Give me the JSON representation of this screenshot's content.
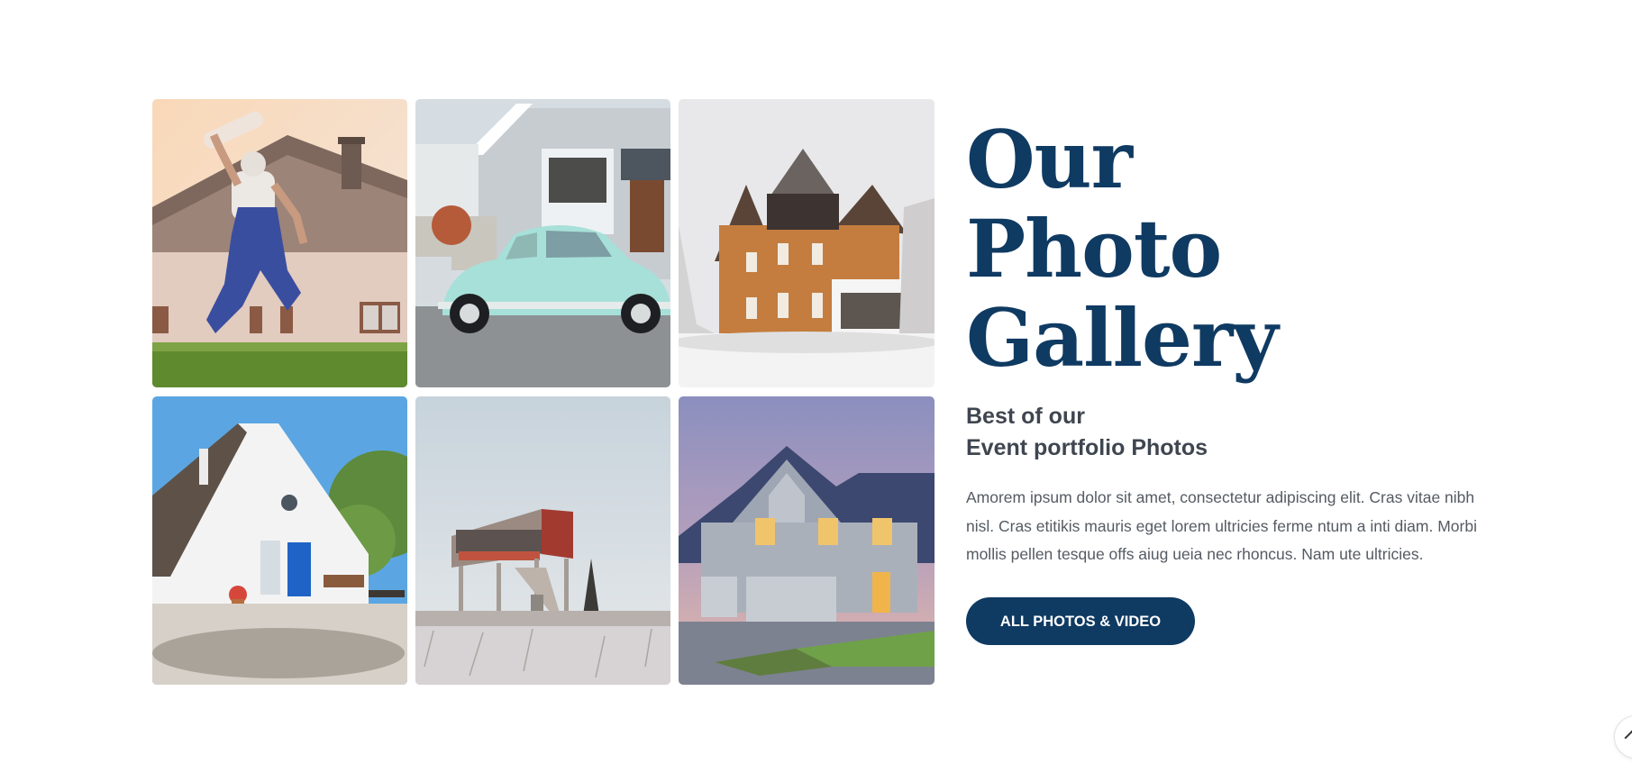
{
  "gallery": {
    "photos": [
      {
        "icon": "worker-jumping-house-photo"
      },
      {
        "icon": "vintage-car-house-photo"
      },
      {
        "icon": "snowy-victorian-house-photo"
      },
      {
        "icon": "white-cottage-photo"
      },
      {
        "icon": "abandoned-building-frost-photo"
      },
      {
        "icon": "modern-house-dusk-photo"
      }
    ]
  },
  "heading": {
    "line1": "Our",
    "line2": "Photo",
    "line3": "Gallery"
  },
  "subheading": {
    "line1": "Best of our",
    "line2": "Event portfolio Photos"
  },
  "description": "Amorem ipsum dolor sit amet, consectetur adipiscing elit. Cras vitae nibh nisl. Cras etitikis mauris eget lorem ultricies ferme ntum a inti diam. Morbi mollis pellen tesque offs aiug ueia nec rhoncus. Nam ute ultricies.",
  "cta": {
    "label": "ALL PHOTOS & VIDEO"
  },
  "scroll_top": {
    "icon": "chevron-up-icon"
  },
  "colors": {
    "accent": "#0f3a62",
    "subheading": "#3f4650",
    "body": "#555b63"
  }
}
